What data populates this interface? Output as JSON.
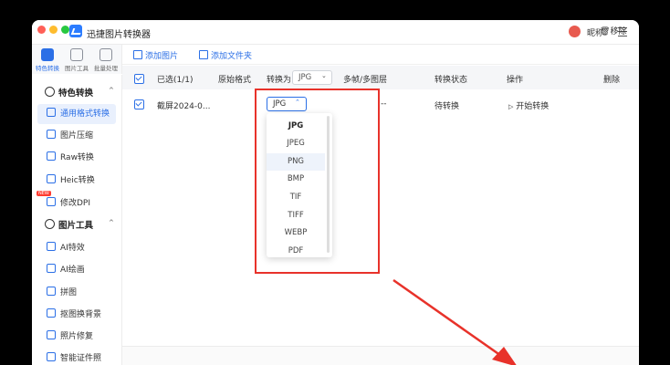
{
  "app": {
    "title": "迅捷图片转换器",
    "nickname": "昵称"
  },
  "window_dots": {
    "close": "#ff5f57",
    "minimize": "#febc2e",
    "maximize": "#28c840"
  },
  "rail": [
    {
      "label": "特色转换"
    },
    {
      "label": "图片工具"
    },
    {
      "label": "批量处理"
    }
  ],
  "sidebar": {
    "section1": {
      "label": "特色转换",
      "chevron": "^"
    },
    "section1_items": [
      {
        "label": "通用格式转换",
        "icon": "format-icon"
      },
      {
        "label": "图片压缩",
        "icon": "compress-icon"
      },
      {
        "label": "Raw转换",
        "icon": "raw-icon"
      },
      {
        "label": "Heic转换",
        "icon": "heic-icon"
      },
      {
        "label": "修改DPI",
        "icon": "dpi-icon",
        "badge": "NEW"
      }
    ],
    "section2": {
      "label": "图片工具",
      "chevron": "^"
    },
    "section2_items": [
      {
        "label": "AI特效",
        "icon": "ai-effect-icon"
      },
      {
        "label": "AI绘画",
        "icon": "ai-paint-icon"
      },
      {
        "label": "拼图",
        "icon": "puzzle-icon"
      },
      {
        "label": "抠图换背景",
        "icon": "cutout-icon"
      },
      {
        "label": "照片修复",
        "icon": "repair-icon"
      },
      {
        "label": "智能证件照",
        "icon": "id-photo-icon"
      }
    ]
  },
  "toolbar": {
    "add_image": "添加图片",
    "add_folder": "添加文件夹",
    "remove": "移除"
  },
  "table": {
    "headers": {
      "selected": "已选(1/1)",
      "original_format": "原始格式",
      "convert_to": "转换为",
      "convert_to_value": "JPG",
      "multi_layer": "多帧/多图层",
      "status": "转换状态",
      "action": "操作",
      "delete": "删除"
    },
    "rows": [
      {
        "name": "截屏2024-0...",
        "format_value": "JPG",
        "multi_layer": "--",
        "status": "待转换",
        "action": "开始转换"
      }
    ]
  },
  "dropdown": {
    "options": [
      "JPG",
      "JPEG",
      "PNG",
      "BMP",
      "TIF",
      "TIFF",
      "WEBP",
      "PDF"
    ],
    "selected": "JPG",
    "hovered": "PNG"
  },
  "colors": {
    "accent": "#2b6fe6",
    "highlight_box": "#e8322a",
    "arrow": "#e8322a"
  }
}
